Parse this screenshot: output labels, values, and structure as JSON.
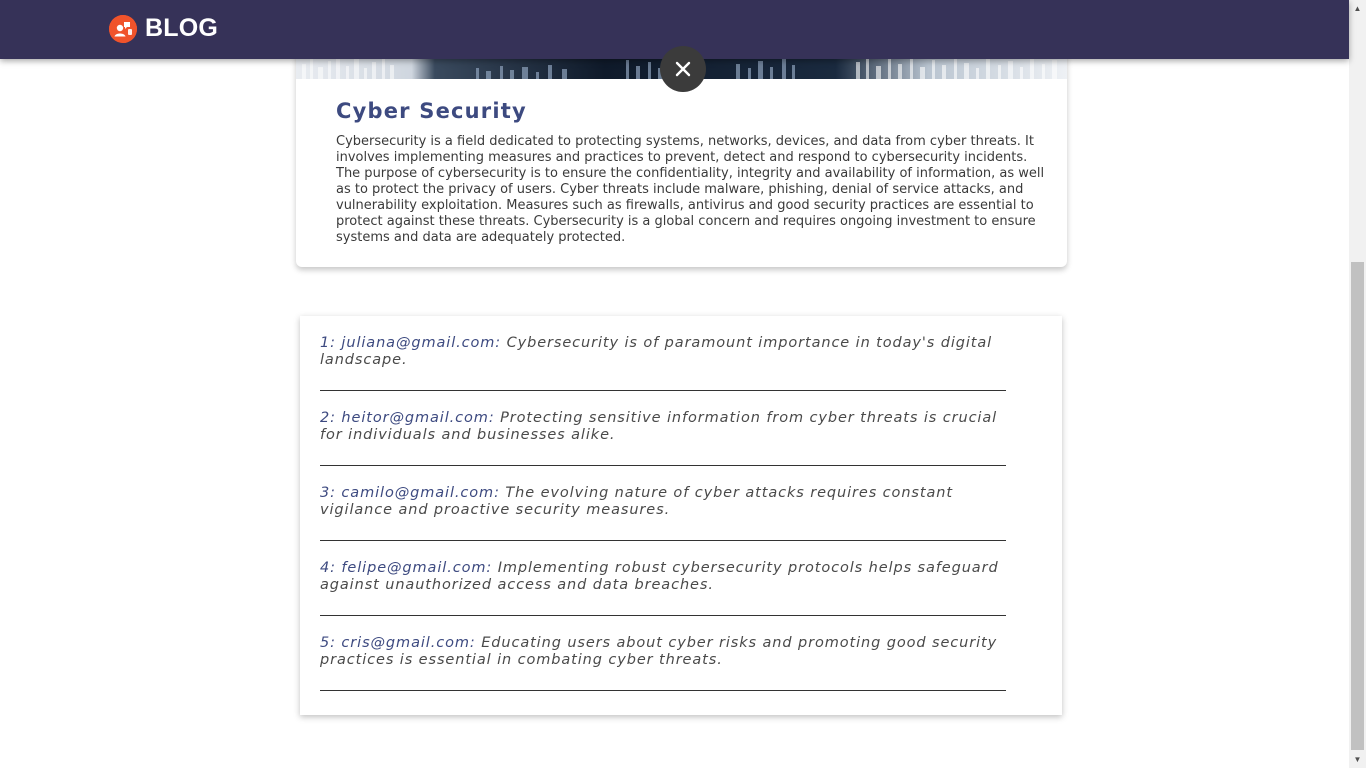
{
  "header": {
    "brand": "BLOG",
    "logo_icon": "blog-logo-icon",
    "background": "#363258",
    "logo_color": "#f0532b"
  },
  "close": {
    "icon": "close-icon"
  },
  "article": {
    "title": "Cyber Security",
    "body": "Cybersecurity is a field dedicated to protecting systems, networks, devices, and data from cyber threats. It involves implementing measures and practices to prevent, detect and respond to cybersecurity incidents. The purpose of cybersecurity is to ensure the confidentiality, integrity and availability of information, as well as to protect the privacy of users. Cyber threats include malware, phishing, denial of service attacks, and vulnerability exploitation. Measures such as firewalls, antivirus and good security practices are essential to protect against these threats. Cybersecurity is a global concern and requires ongoing investment to ensure systems and data are adequately protected.",
    "title_color": "#3d4a80"
  },
  "comments": [
    {
      "author": "1: juliana@gmail.com:",
      "text": "Cybersecurity is of paramount importance in today's digital landscape."
    },
    {
      "author": "2: heitor@gmail.com:",
      "text": "Protecting sensitive information from cyber threats is crucial for individuals and businesses alike."
    },
    {
      "author": "3: camilo@gmail.com:",
      "text": "The evolving nature of cyber attacks requires constant vigilance and proactive security measures."
    },
    {
      "author": "4: felipe@gmail.com:",
      "text": "Implementing robust cybersecurity protocols helps safeguard against unauthorized access and data breaches."
    },
    {
      "author": "5: cris@gmail.com:",
      "text": "Educating users about cyber risks and promoting good security practices is essential in combating cyber threats."
    }
  ],
  "scrollbar": {
    "up_icon": "scroll-up-arrow-icon",
    "down_icon": "scroll-down-arrow-icon"
  }
}
